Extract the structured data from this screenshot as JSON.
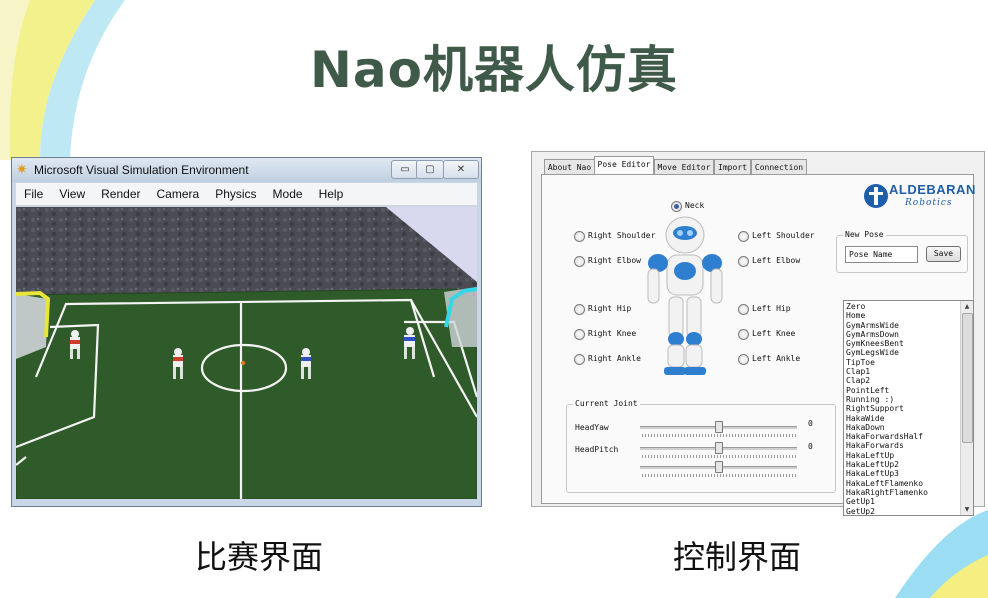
{
  "slide": {
    "title": "Nao机器人仿真",
    "captions": {
      "left": "比赛界面",
      "right": "控制界面"
    }
  },
  "sim_window": {
    "title": "Microsoft Visual Simulation Environment",
    "icon": "gear-icon",
    "controls": {
      "minimize": "▭",
      "maximize": "▢",
      "close": "✕"
    },
    "menu": [
      "File",
      "View",
      "Render",
      "Camera",
      "Physics",
      "Mode",
      "Help"
    ]
  },
  "pose_editor": {
    "tabs": [
      "About Nao",
      "Pose Editor",
      "Move Editor",
      "Import",
      "Connection"
    ],
    "active_tab": 1,
    "logo": {
      "brand": "ALDEBARAN",
      "sub": "Robotics"
    },
    "joints": {
      "neck": "Neck",
      "right_shoulder": "Right Shoulder",
      "right_elbow": "Right Elbow",
      "right_hip": "Right Hip",
      "right_knee": "Right Knee",
      "right_ankle": "Right Ankle",
      "left_shoulder": "Left Shoulder",
      "left_elbow": "Left Elbow",
      "left_hip": "Left Hip",
      "left_knee": "Left Knee",
      "left_ankle": "Left Ankle"
    },
    "selected_joint": "Neck",
    "new_pose": {
      "legend": "New Pose",
      "name_value": "Pose Name",
      "save_label": "Save"
    },
    "current_joint": {
      "legend": "Current Joint",
      "sliders": [
        {
          "label": "HeadYaw",
          "value": "0",
          "position": 0.5
        },
        {
          "label": "HeadPitch",
          "value": "0",
          "position": 0.5
        },
        {
          "label": "",
          "value": "",
          "position": 0.5
        }
      ]
    },
    "poses": [
      "Zero",
      "Home",
      "GymArmsWide",
      "GymArmsDown",
      "GymKneesBent",
      "GymLegsWide",
      "TipToe",
      "Clap1",
      "Clap2",
      "PointLeft",
      "Running :)",
      "RightSupport",
      "HakaWide",
      "HakaDown",
      "HakaForwardsHalf",
      "HakaForwards",
      "HakaLeftUp",
      "HakaLeftUp2",
      "HakaLeftUp3",
      "HakaLeftFlamenko",
      "HakaRightFlamenko",
      "GetUp1",
      "GetUp2"
    ]
  },
  "colors": {
    "title_green": "#3f5a48",
    "field_green": "#2f5a2a",
    "goal_yellow": "#e8e63a",
    "goal_cyan": "#35d6e6",
    "team_red": "#d23a2a",
    "team_blue": "#2f4fc4",
    "nao_blue": "#2f7fd0"
  }
}
